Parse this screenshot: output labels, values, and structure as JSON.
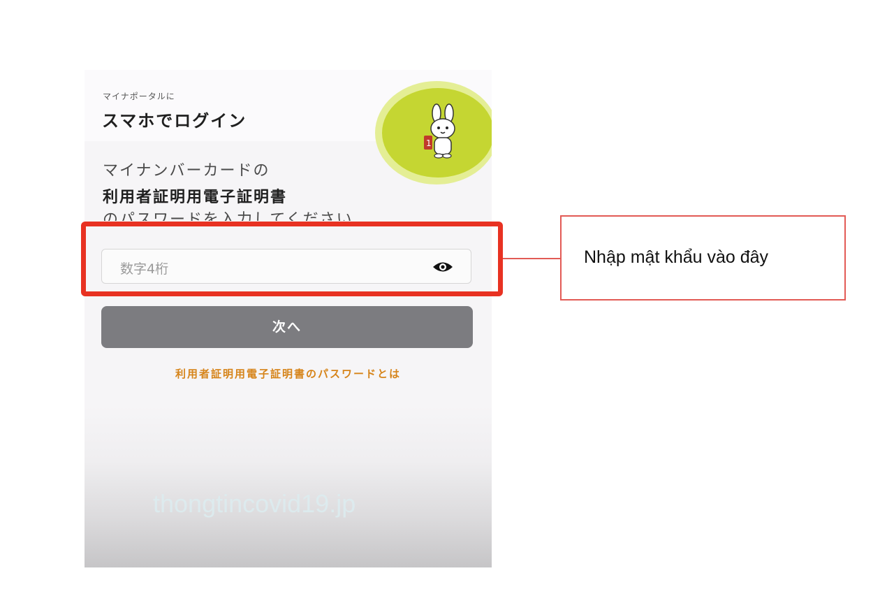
{
  "header": {
    "subtitle": "マイナポータルに",
    "title": "スマホでログイン"
  },
  "instructions": {
    "line1": "マイナンバーカードの",
    "line2": "利用者証明用電子証明書",
    "line3": "のパスワードを入力してください"
  },
  "password_field": {
    "placeholder": "数字4桁",
    "icon": "eye-icon"
  },
  "next_button": {
    "label": "次へ",
    "color": "#7c7c80"
  },
  "help_link": {
    "label": "利用者証明用電子証明書のパスワードとは",
    "color": "#d6841a"
  },
  "watermark": {
    "text": "thongtincovid19.jp"
  },
  "annotation": {
    "callout_text": "Nhập mật khẩu vào đây",
    "highlight_color": "#e83222"
  },
  "mascot": {
    "icon": "rabbit-mascot-icon",
    "circle_color": "#c5d632"
  }
}
